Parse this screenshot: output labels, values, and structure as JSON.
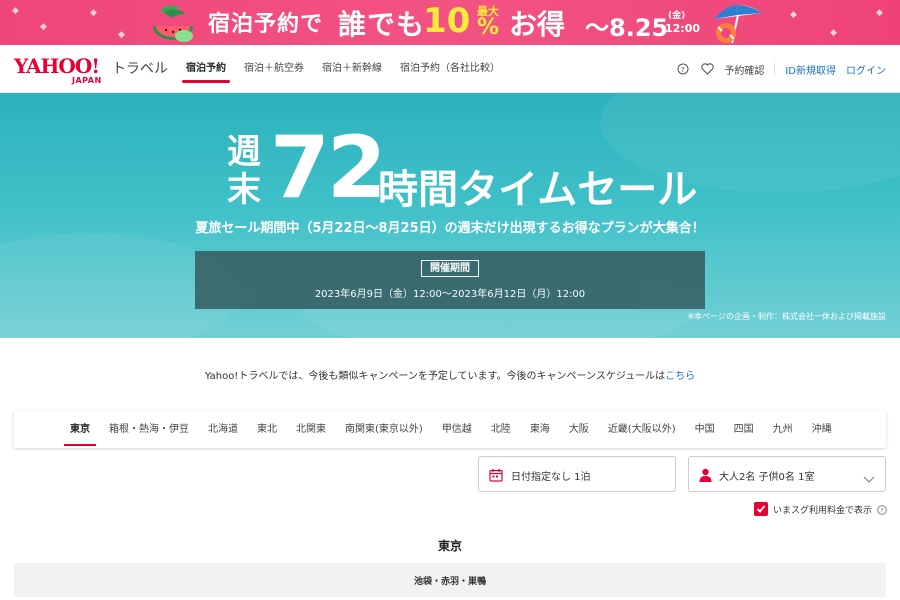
{
  "promo": {
    "text1": "宿泊予約で",
    "text2": "誰でも",
    "percent": "10",
    "max_label": "最大",
    "percent_sign": "%",
    "text3": "お得",
    "date": "～8.25",
    "day": "(金)",
    "time": "12:00"
  },
  "header": {
    "logo_text": "YAHOO!",
    "logo_sub": "JAPAN",
    "logo_service": "トラベル",
    "nav": [
      "宿泊予約",
      "宿泊＋航空券",
      "宿泊＋新幹線",
      "宿泊予約（各社比較）"
    ],
    "links": {
      "reservation": "予約確認",
      "register": "ID新規取得",
      "login": "ログイン"
    }
  },
  "hero": {
    "small_text": "週末",
    "number": "72",
    "title": "時間タイムセール",
    "subtitle": "夏旅セール期間中（5月22日～8月25日）の週末だけ出現するお得なプランが大集合！",
    "period_label": "開催期間",
    "period_dates": "2023年6月9日（金）12:00～2023年6月12日（月）12:00",
    "credit": "※本ページの企画・制作：株式会社一休および掲載施設"
  },
  "notice": {
    "text": "Yahoo!トラベルでは、今後も類似キャンペーンを予定しています。今後のキャンペーンスケジュールは",
    "link": "こちら"
  },
  "regions": [
    "東京",
    "箱根・熱海・伊豆",
    "北海道",
    "東北",
    "北関東",
    "南関東(東京以外)",
    "甲信越",
    "北陸",
    "東海",
    "大阪",
    "近畿(大阪以外)",
    "中国",
    "四国",
    "九州",
    "沖縄"
  ],
  "search": {
    "date_value": "日付指定なし 1泊",
    "guest_value": "大人2名 子供0名 1室",
    "checkbox_label": "いまスグ利用料金で表示"
  },
  "area": {
    "title": "東京",
    "sub_area": "池袋・赤羽・巣鴨"
  },
  "colors": {
    "brand_red": "#e60033",
    "promo_pink": "#f0457a",
    "hero_teal": "#2cb2bd",
    "link_blue": "#1a73c8"
  }
}
